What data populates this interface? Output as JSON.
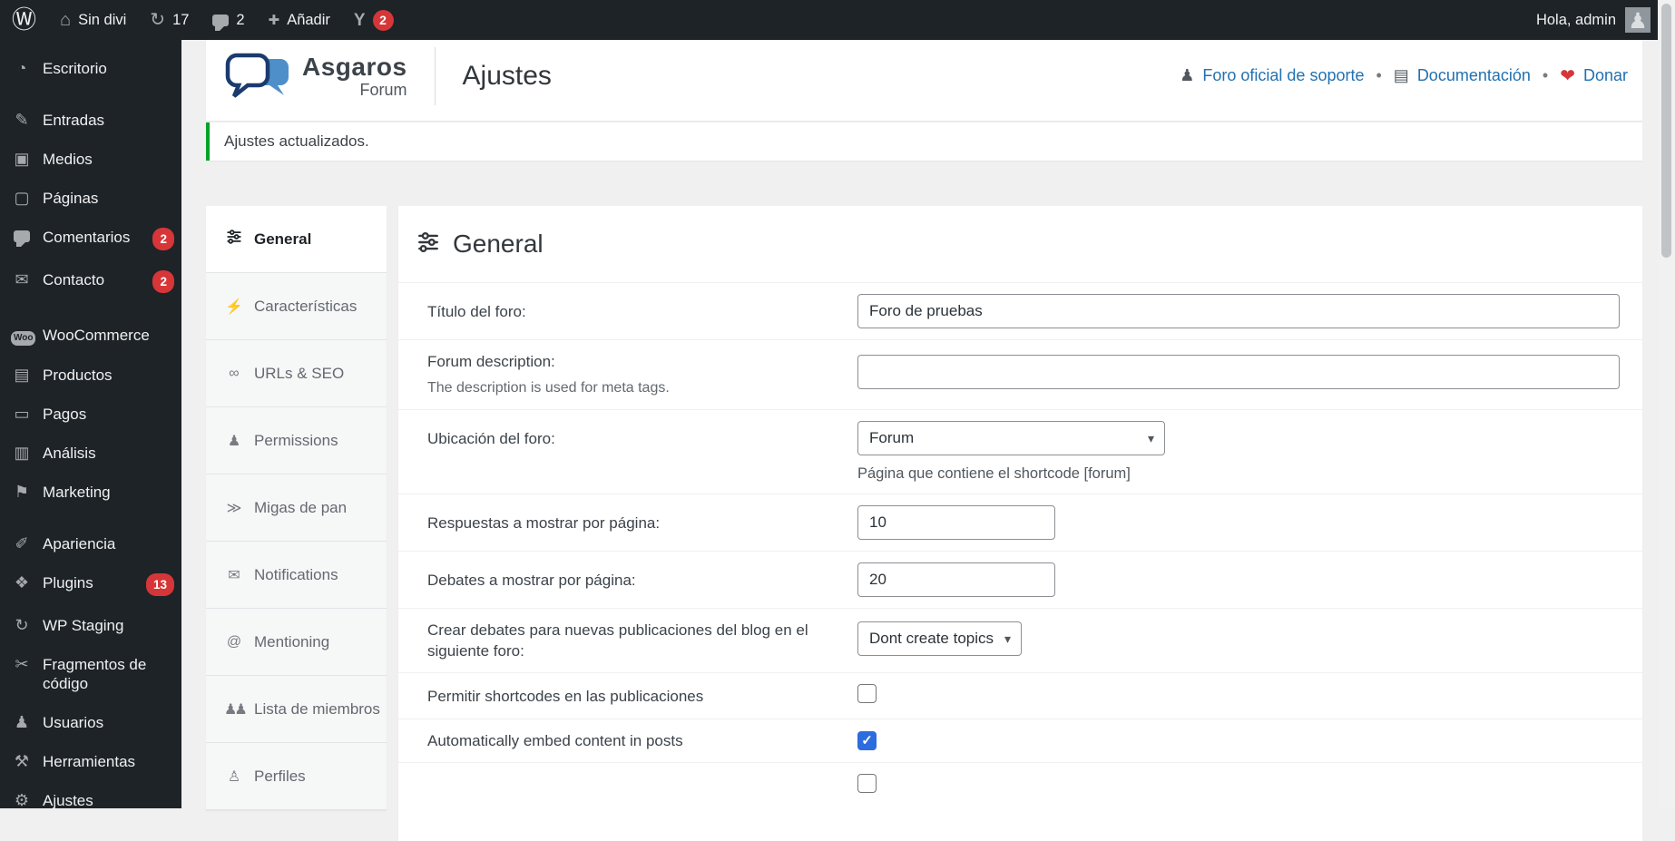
{
  "colors": {
    "admin_dark": "#1d2327",
    "link_blue": "#2271b1",
    "badge_red": "#d63638",
    "notice_green": "#00a32a",
    "checkbox_checked_blue": "#2d6cdf"
  },
  "icons": {
    "wp_logo": "Ⓦ",
    "home": "⌂",
    "updates": "↻",
    "add": "✚",
    "yoast": "Y",
    "avatar": "♟",
    "dashboard": "◔",
    "posts": "✎",
    "media": "▣",
    "pages": "▢",
    "contact": "✉",
    "woocommerce": "Woo",
    "products": "▤",
    "payments": "▭",
    "analytics": "▥",
    "marketing": "⚑",
    "appearance": "✐",
    "plugins": "❖",
    "wp_staging": "↻",
    "code_snippets": "✂",
    "users": "♟",
    "tools": "⚒",
    "settings": "⚙",
    "support": "♟",
    "documentation": "▤",
    "donate": "❤",
    "features": "⚡",
    "urls_seo": "∞",
    "permissions": "♟",
    "breadcrumbs": "≫",
    "notifications": "✉",
    "mentioning": "@",
    "members": "♟♟",
    "profiles": "♙",
    "chevron": "▾",
    "check": "✓",
    "dot": "•"
  },
  "admin_bar": {
    "site_name": "Sin divi",
    "updates_count": "17",
    "comments_count": "2",
    "add_label": "Añadir",
    "yoast_badge": "2",
    "greeting": "Hola, admin"
  },
  "sidebar": {
    "items": [
      {
        "label": "Escritorio"
      },
      {
        "label": "Entradas"
      },
      {
        "label": "Medios"
      },
      {
        "label": "Páginas"
      },
      {
        "label": "Comentarios",
        "badge": "2"
      },
      {
        "label": "Contacto",
        "badge": "2"
      },
      {
        "label": "WooCommerce"
      },
      {
        "label": "Productos"
      },
      {
        "label": "Pagos"
      },
      {
        "label": "Análisis"
      },
      {
        "label": "Marketing"
      },
      {
        "label": "Apariencia"
      },
      {
        "label": "Plugins",
        "badge": "13"
      },
      {
        "label": "WP Staging"
      },
      {
        "label": "Fragmentos de código"
      },
      {
        "label": "Usuarios"
      },
      {
        "label": "Herramientas"
      },
      {
        "label": "Ajustes"
      }
    ]
  },
  "header": {
    "brand": "Asgaros",
    "brand_sub": "Forum",
    "title": "Ajustes",
    "link_support": "Foro oficial de soporte",
    "link_docs": "Documentación",
    "link_donate": "Donar"
  },
  "notice": {
    "message": "Ajustes actualizados."
  },
  "tabs": {
    "items": [
      {
        "label": "General"
      },
      {
        "label": "Características"
      },
      {
        "label": "URLs & SEO"
      },
      {
        "label": "Permissions"
      },
      {
        "label": "Migas de pan"
      },
      {
        "label": "Notifications"
      },
      {
        "label": "Mentioning"
      },
      {
        "label": "Lista de miembros"
      },
      {
        "label": "Perfiles"
      }
    ]
  },
  "settings": {
    "title": "General",
    "rows": [
      {
        "label": "Título del foro:",
        "value": "Foro de pruebas"
      },
      {
        "label": "Forum description:",
        "helper": "The description is used for meta tags.",
        "value": ""
      },
      {
        "label": "Ubicación del foro:",
        "value": "Forum",
        "helper": "Página que contiene el shortcode [forum]"
      },
      {
        "label": "Respuestas a mostrar por página:",
        "value": "10"
      },
      {
        "label": "Debates a mostrar por página:",
        "value": "20"
      },
      {
        "label": "Crear debates para nuevas publicaciones del blog en el siguiente foro:",
        "value": "Dont create topics"
      },
      {
        "label": "Permitir shortcodes en las publicaciones",
        "checked": false
      },
      {
        "label": "Automatically embed content in posts",
        "checked": true
      },
      {
        "label": "",
        "checked": false
      }
    ]
  }
}
